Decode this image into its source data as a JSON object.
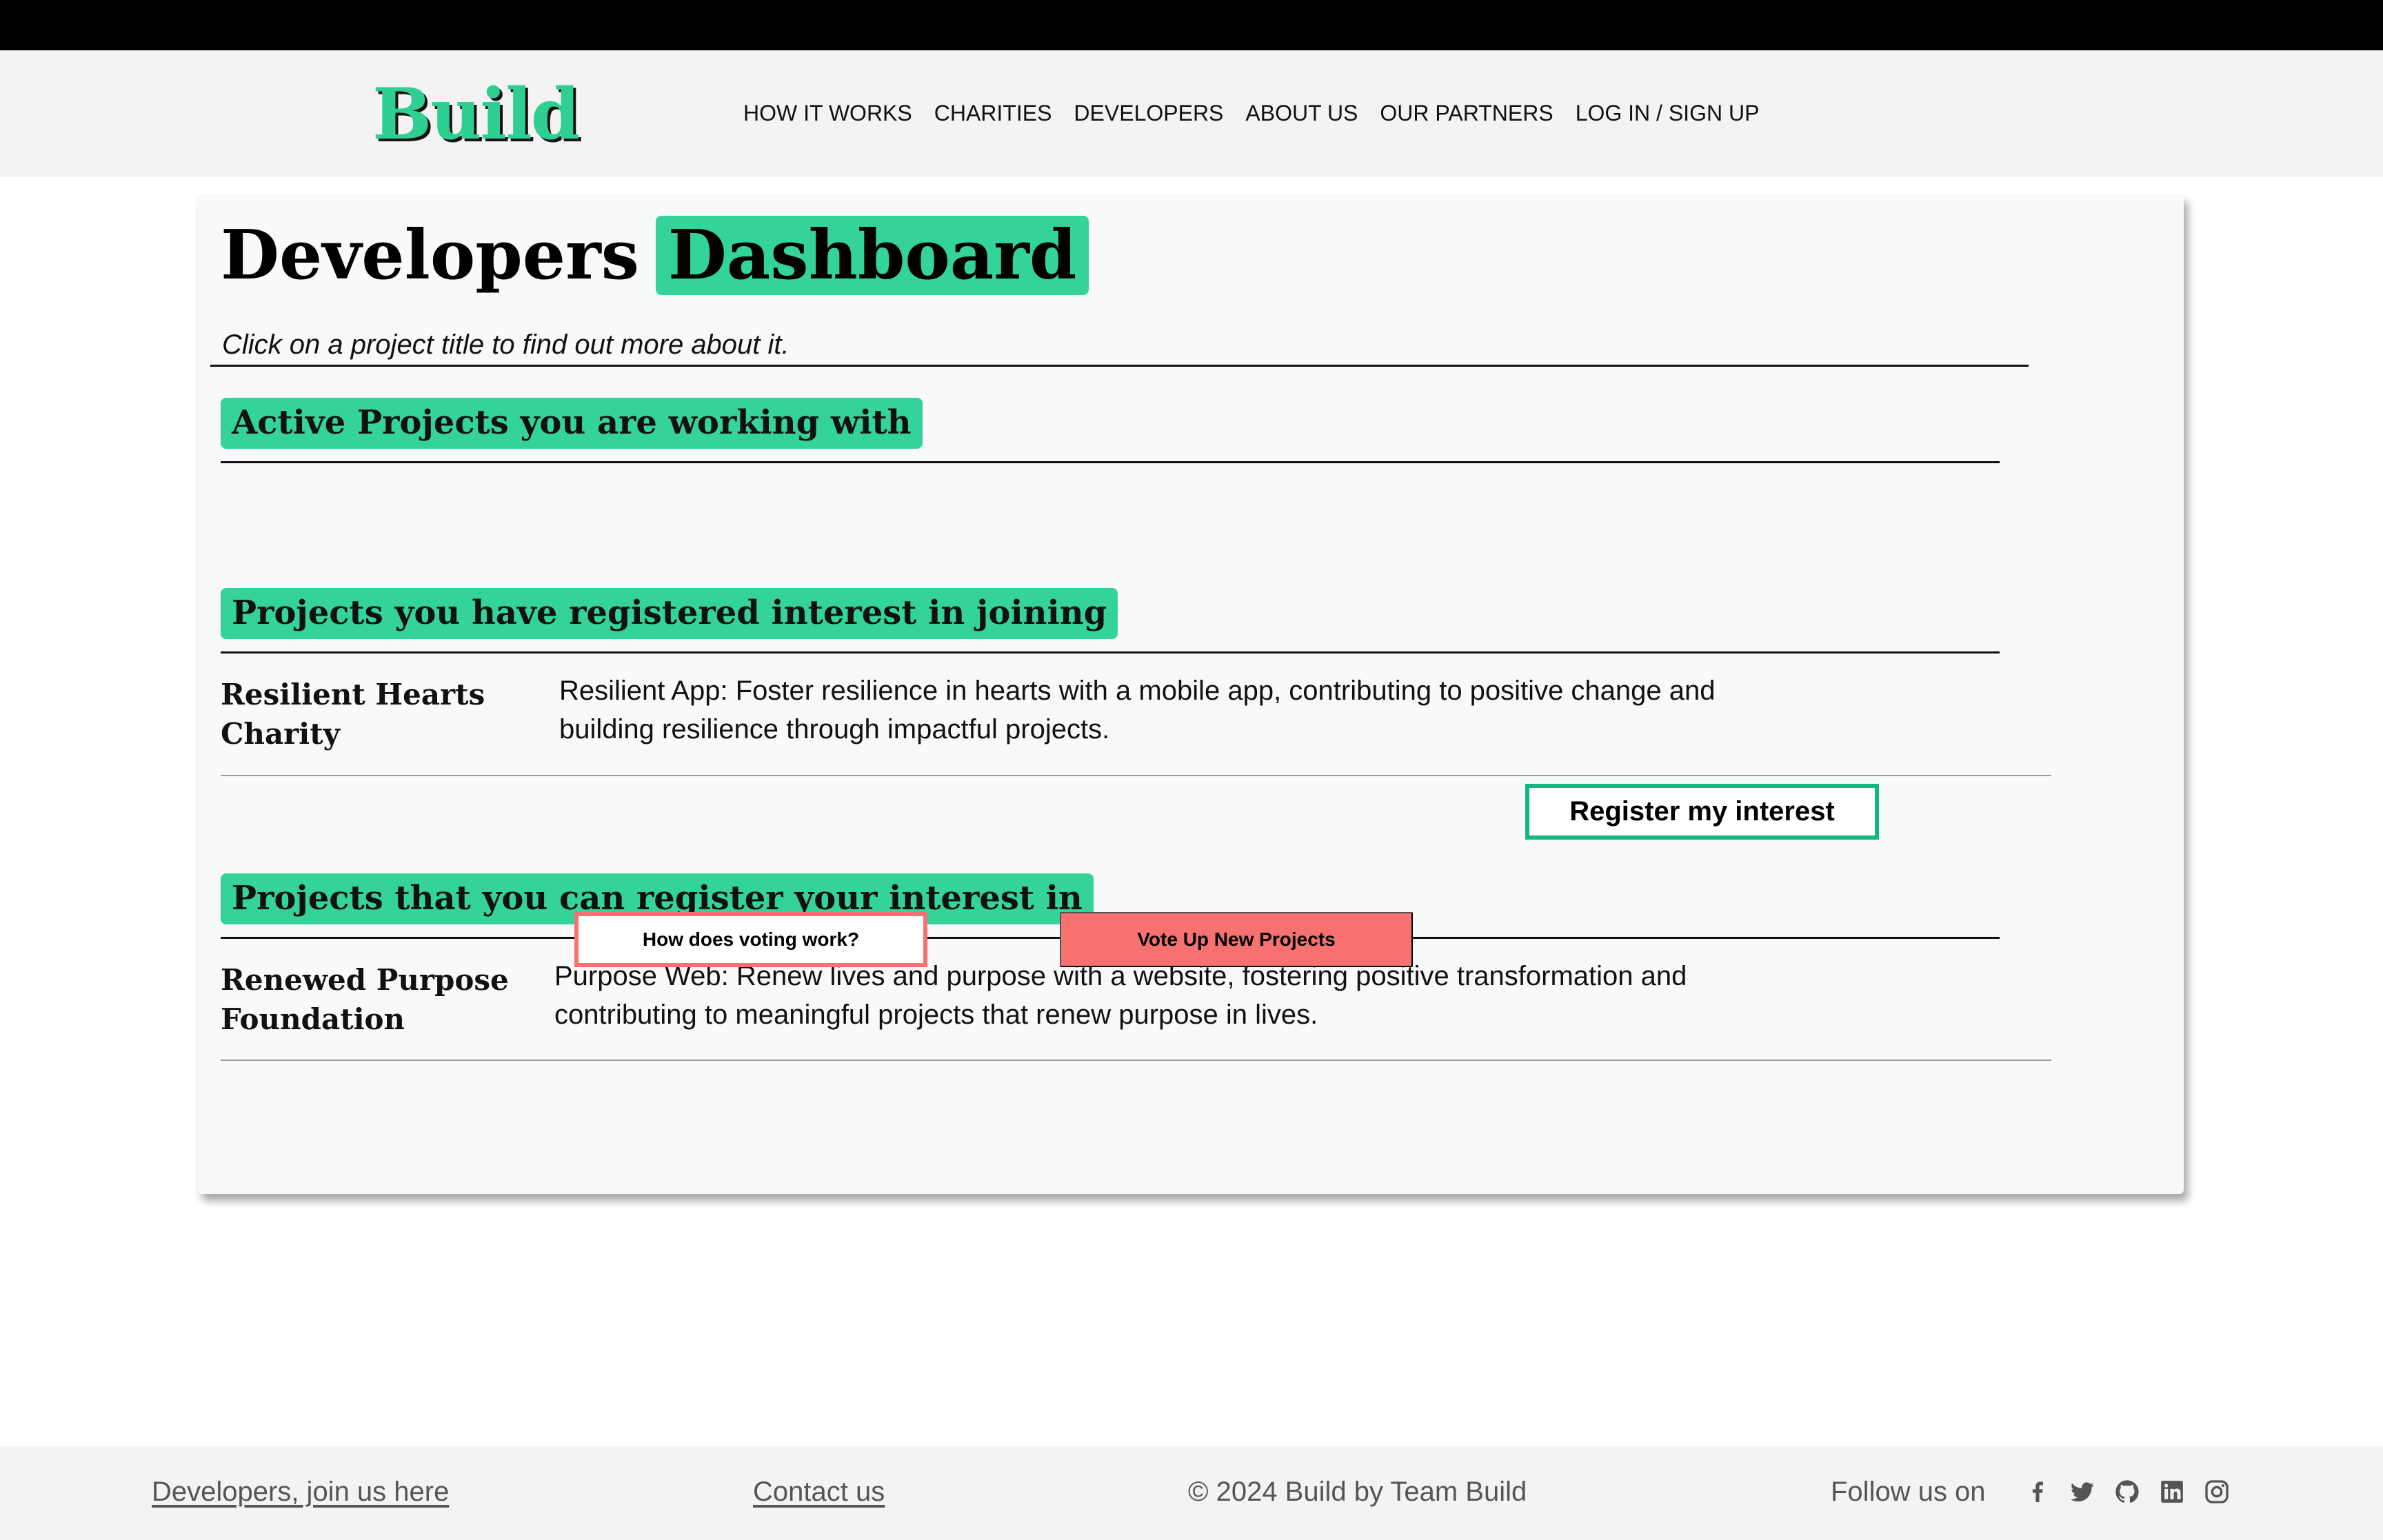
{
  "brand": {
    "logo": "Build"
  },
  "nav": {
    "items": [
      "HOW IT WORKS",
      "CHARITIES",
      "DEVELOPERS",
      "ABOUT US",
      "OUR PARTNERS",
      "LOG IN / SIGN UP"
    ]
  },
  "dashboard": {
    "title_main": "Developers",
    "title_highlight": "Dashboard",
    "subtitle": "Click on a project title to find out more about it."
  },
  "sections": {
    "active": {
      "heading": "Active Projects you are working with"
    },
    "registered": {
      "heading": "Projects you have registered interest in joining",
      "projects": [
        {
          "charity": "Resilient Hearts Charity",
          "description": "Resilient App: Foster resilience in hearts with a mobile app, contributing to positive change and building resilience through impactful projects."
        }
      ]
    },
    "available": {
      "heading": "Projects that you can register your interest in",
      "projects": [
        {
          "charity": "Renewed Purpose Foundation",
          "description": "Purpose Web: Renew lives and purpose with a website, fostering positive transformation and contributing to meaningful projects that renew purpose in lives.",
          "button": "Register my interest"
        }
      ]
    }
  },
  "actions": {
    "voting_info": "How does voting work?",
    "vote_up": "Vote Up New Projects"
  },
  "footer": {
    "join": "Developers, join us here",
    "contact": "Contact us",
    "copyright": "© 2024 Build by Team Build",
    "follow": "Follow us on",
    "social_icons": [
      "facebook-icon",
      "twitter-icon",
      "github-icon",
      "linkedin-icon",
      "instagram-icon"
    ]
  },
  "colors": {
    "accent": "#34d399",
    "accent_border": "#10b981",
    "vote": "#f87171",
    "header_bg": "#f3f3f3",
    "card_bg": "#f8f9fa"
  }
}
